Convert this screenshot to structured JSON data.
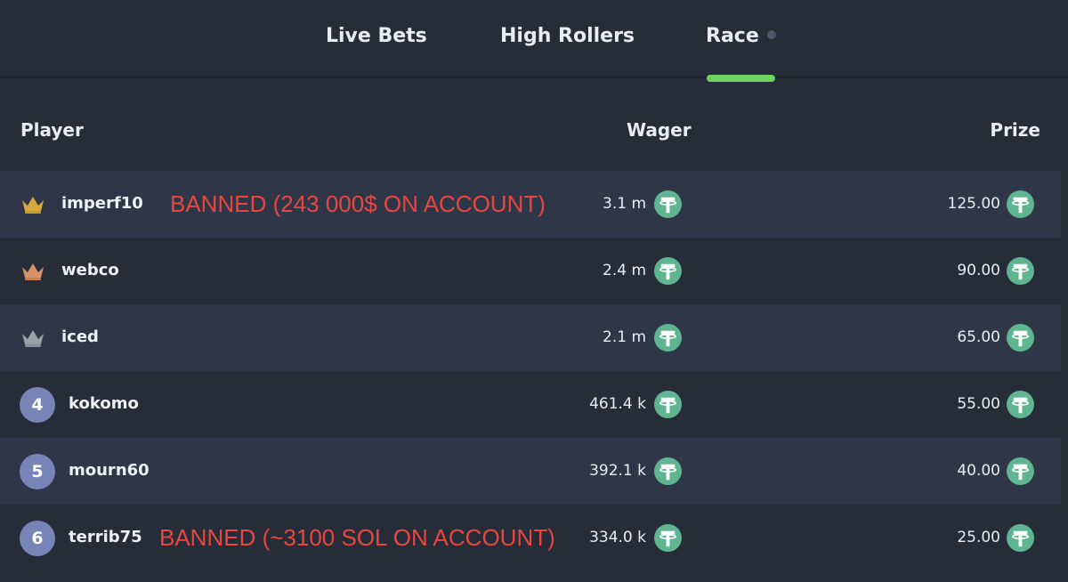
{
  "tabs": [
    {
      "label": "Live Bets"
    },
    {
      "label": "High Rollers"
    },
    {
      "label": "Race"
    }
  ],
  "colors": {
    "background": "#262c38",
    "row_alt": "#2e3647",
    "accent": "#6fd15e",
    "banned_note": "#e8463f",
    "tether": "#5fb592",
    "crown_gold": "#d5a93c",
    "crown_bronze": "#d99068",
    "crown_silver": "#9aa0a9",
    "rank_badge": "#7684b8"
  },
  "table": {
    "headers": {
      "player": "Player",
      "wager": "Wager",
      "prize": "Prize"
    },
    "currency_icon": "tether-usdt-icon",
    "rows": [
      {
        "rank_icon": "gold-crown-icon",
        "player": "imperf10",
        "note": "BANNED (243 000$ ON ACCOUNT)",
        "wager": "3.1 m",
        "prize": "125.00"
      },
      {
        "rank_icon": "bronze-crown-icon",
        "player": "webco",
        "wager": "2.4 m",
        "prize": "90.00"
      },
      {
        "rank_icon": "silver-crown-icon",
        "player": "iced",
        "wager": "2.1 m",
        "prize": "65.00"
      },
      {
        "rank": "4",
        "player": "kokomo",
        "wager": "461.4 k",
        "prize": "55.00"
      },
      {
        "rank": "5",
        "player": "mourn60",
        "wager": "392.1 k",
        "prize": "40.00"
      },
      {
        "rank": "6",
        "player": "terrib75",
        "note": "BANNED (~3100 SOL ON ACCOUNT)",
        "wager": "334.0 k",
        "prize": "25.00"
      }
    ]
  }
}
